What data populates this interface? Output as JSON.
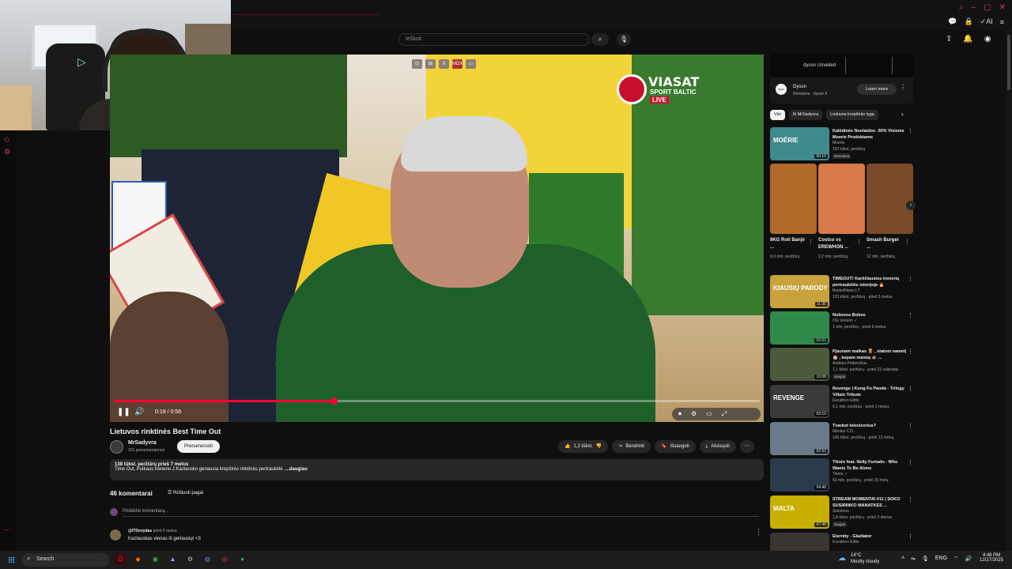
{
  "browser": {
    "window_controls": [
      "⌕",
      "–",
      "▢",
      "✕"
    ],
    "ext_icons": [
      "💬",
      "🔒",
      "✓AI",
      "≡"
    ]
  },
  "search": {
    "placeholder": "Ieškoti"
  },
  "video": {
    "title": "Lietuvos rinktinės Best Time Out",
    "overlay": {
      "brand": "VIASAT",
      "sub": "SPORT BALTIC",
      "live": "LIVE"
    },
    "ext_badges": [
      "⊡",
      "⊞",
      "‖",
      "MDX",
      "▭"
    ],
    "time": "0:19 / 0:56",
    "progress_fraction": 0.34
  },
  "channel": {
    "name": "MrSadyvra",
    "subscribers": "201 prenumeratorius",
    "subscribe_label": "Prenumeruoti"
  },
  "actions": {
    "like": "1,2 tūkst.",
    "share": "Bendrinti",
    "save": "Išsaugoti",
    "download": "Atsisiųsti"
  },
  "description": {
    "meta": "138 tūkst. peržiūrų  prieš 7 metus",
    "text": "Time Out, Puikaus trenerio J.Kazlausko geriausia krepšinio rinktinės pertraukėlė.",
    "more": "...daugiau"
  },
  "comments": {
    "count_label": "46 komentarai",
    "sort_label": "Rūšiuoti pagal",
    "add_placeholder": "Pridėkite komentarą...",
    "first": {
      "author": "@ITDovydas",
      "time": "prieš 5 metus",
      "text": "Kazlauskas vienas iš geriausių! <3"
    }
  },
  "ad": {
    "banner_text": "dyson Unveiled",
    "logo": "dyson",
    "name": "Dyson",
    "sponsor": "Remiama · dyson.lt",
    "button": "Learn more"
  },
  "chips": [
    "Visi",
    "Iš MrSadyvra",
    "Lietuvos krepšinio lyga"
  ],
  "recommendations": [
    {
      "title": "Kalėdinės Nuolaidos -30% Visiems Moerie Produktams",
      "channel": "Moerie",
      "meta": "162 tūkst. peržiūrų",
      "badge": "Remiama",
      "duration": "00:10",
      "thumb_text": "MOÉRIE",
      "color": "#3f8a8a"
    },
    {
      "title": "TIMEOUT! Karščiausios trenerių pertraukėlės istorijoje 🔥",
      "channel": "BasketNews.LT",
      "meta": "133 tūkst. peržiūrų · prieš 5 metus",
      "badge": "",
      "duration": "11:35",
      "thumb_text": "KIAUSIŲ PARODY",
      "color": "#c8a23a"
    },
    {
      "title": "Nuliovos Bobos",
      "channel": "OG Version ✓",
      "meta": "1 mln. peržiūrų · prieš 6 metus",
      "badge": "",
      "duration": "02:01",
      "thumb_text": "",
      "color": "#2f8a4a"
    },
    {
      "title": "Pjaunam malkas 🪵 , statom namelį 🏠 , kepam maistą 🍲 ...",
      "channel": "Audrius Petkevičius",
      "meta": "1,1 tūkst. peržiūrų · prieš 22 valandas",
      "badge": "Naujas",
      "duration": "13:08",
      "thumb_text": "",
      "color": "#4a5a3a"
    },
    {
      "title": "Revenge | Kung Fu Panda - Trilogy Villain Tribute",
      "channel": "Escathon Edits",
      "meta": "5,1 mln. peržiūrų · prieš 3 metus",
      "badge": "",
      "duration": "03:10",
      "thumb_text": "REVENGE",
      "color": "#3a3a3a"
    },
    {
      "title": "Tvarkot televizorius?",
      "channel": "Mantas CZL",
      "meta": "146 tūkst. peržiūrų · prieš 13 mėnų",
      "badge": "",
      "duration": "02:52",
      "thumb_text": "",
      "color": "#6a7a8a"
    },
    {
      "title": "Tiësto feat. Nelly Furtado - Who Wants To Be Alone",
      "channel": "Tiësto ✓",
      "meta": "53 mln. peržiūrų · prieš 15 metų",
      "badge": "",
      "duration": "04:46",
      "thumb_text": "",
      "color": "#2a3a4a"
    },
    {
      "title": "STREAM MOMENTAI #11 | SOKO SUSIRINKO MANATKES ...",
      "channel": "Sokolooo",
      "meta": "1,8 tūkst. peržiūrų · prieš 3 dienas",
      "badge": "Naujas",
      "duration": "07:48",
      "thumb_text": "MALTA",
      "color": "#c8b000"
    },
    {
      "title": "Eternity - Gladiator",
      "channel": "Escathon Edits",
      "meta": "",
      "badge": "",
      "duration": "",
      "thumb_text": "",
      "color": "#3a3530"
    }
  ],
  "shorts": [
    {
      "title": "9KG Roti Banjir ...",
      "views": "9,9 mln. peržiūrų",
      "color": "#b06a2a"
    },
    {
      "title": "Costco vs EREWHON ...",
      "views": "2,2 mln. peržiūrų",
      "color": "#d87a4a"
    },
    {
      "title": "Smash Burger ...",
      "views": "12 mln. peržiūrų",
      "color": "#7a4a2a"
    }
  ],
  "taskbar": {
    "search": "Search",
    "weather_temp": "14°C",
    "weather_cond": "Mostly cloudy",
    "lang": "ENG",
    "time": "4:48 PM",
    "date": "12/27/2025"
  },
  "colors": {
    "accent": "#ff0033",
    "bg": "#0f0f0f"
  }
}
